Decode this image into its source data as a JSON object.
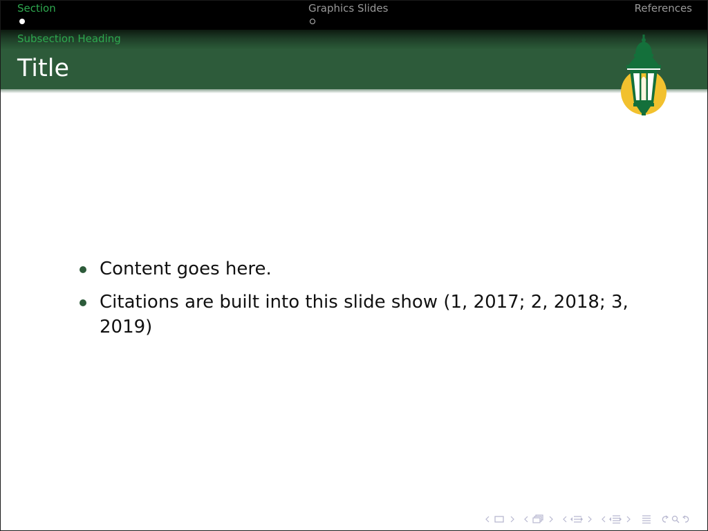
{
  "navbar": {
    "sections": [
      {
        "label": "Section",
        "active": true
      },
      {
        "label": "Graphics Slides",
        "active": false
      },
      {
        "label": "References",
        "active": false
      }
    ]
  },
  "header": {
    "subsection": "Subsection Heading",
    "title": "Title"
  },
  "logo": {
    "icon": "lantern-logo-icon",
    "colors": {
      "green": "#14703b",
      "gold": "#f2c12e"
    }
  },
  "content": {
    "bullets": [
      "Content goes here.",
      "Citations are built into this slide show (1, 2017; 2, 2018; 3, 2019)"
    ]
  },
  "nav_symbols": [
    "frame-nav-icon",
    "subsection-nav-icon",
    "section-nav-icon",
    "presentation-nav-icon",
    "appendix-nav-icon",
    "back-forward-search-icon"
  ],
  "colors": {
    "accent_green": "#2ea84f",
    "title_band": "#2d5b3a",
    "navbar": "#000000"
  }
}
